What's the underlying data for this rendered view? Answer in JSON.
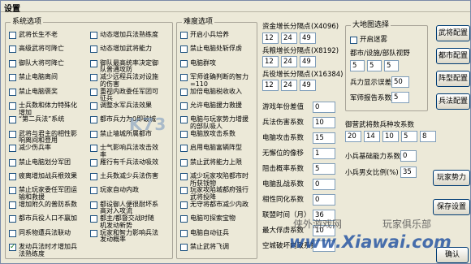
{
  "title": "设置",
  "groups": {
    "system": "系统选项",
    "difficulty": "难度选项",
    "map": "大地图选择",
    "guild": "御营武将数兵种攻系数"
  },
  "system_options": [
    {
      "label": "武将长生不老",
      "checked": false
    },
    {
      "label": "高级武将可降亡",
      "checked": false
    },
    {
      "label": "御队大将可降亡",
      "checked": false
    },
    {
      "label": "禁止电脑离间",
      "checked": false
    },
    {
      "label": "禁止电脑褒奖",
      "checked": false
    },
    {
      "label": "士兵数和体力特殊化增加",
      "checked": false
    },
    {
      "label": "“第二兵法”系统",
      "checked": false
    },
    {
      "label": "武将与君主的相性影响离间和登用",
      "checked": false
    },
    {
      "label": "减少伤兵率",
      "checked": false
    },
    {
      "label": "禁止电脑划分军团",
      "checked": false
    },
    {
      "label": "疲离增加战兵根效果",
      "checked": false
    },
    {
      "label": "禁止玩家委任军团运输和救援",
      "checked": false
    },
    {
      "label": "增加附久的普防系数",
      "checked": false
    },
    {
      "label": "都市兵役人口不赢加",
      "checked": false
    },
    {
      "label": "同系物遭兵法联动",
      "checked": false
    },
    {
      "label": "发动兵法时才增加兵法熟练度",
      "checked": true
    }
  ],
  "system_options_2": [
    {
      "label": "动态增加兵法熟练度",
      "checked": false
    },
    {
      "label": "动态增加武将能力",
      "checked": false
    },
    {
      "label": "御队最高统率决定御队普通攻防",
      "checked": false
    },
    {
      "label": "减少远程兵法对设施的伤害",
      "checked": false
    },
    {
      "label": "重视内政委任军团可征兵",
      "checked": false
    },
    {
      "label": "调整水军兵法效果",
      "checked": false
    },
    {
      "label": "都市兵力为0即破城",
      "checked": false
    },
    {
      "label": "禁止墙城所属都市",
      "checked": false
    },
    {
      "label": "士气影响兵法攻击效率",
      "checked": false
    },
    {
      "label": "雁行有千兵法动吸效",
      "checked": false
    },
    {
      "label": "土兵数减少兵法伤害",
      "checked": false
    },
    {
      "label": "玩家自动内政",
      "checked": false
    },
    {
      "label": "都设御人便很耐坏系高对入攻流",
      "checked": false
    },
    {
      "label": "都主/都督交战时随机发动新势",
      "checked": false
    },
    {
      "label": "玩家和智力影响兵法发动概率",
      "checked": false
    }
  ],
  "difficulty_options": [
    {
      "label": "开启小兵培养",
      "checked": false
    },
    {
      "label": "禁止电脑处斩俘虏",
      "checked": false
    },
    {
      "label": "电脑群攻",
      "checked": false
    },
    {
      "label": "军师谁确判断的智力=110",
      "checked": false
    },
    {
      "label": "加倍电脑税收收入",
      "checked": false
    },
    {
      "label": "允许电脑援力救援",
      "checked": false
    },
    {
      "label": "电脑与玩家势力增援的部队吸人",
      "checked": false
    },
    {
      "label": "电脑放攻击系数",
      "checked": false
    },
    {
      "label": "启用电脑富辆阵型",
      "checked": false
    },
    {
      "label": "禁止武将能力上限",
      "checked": false
    },
    {
      "label": "减少玩家攻陷都市时所获钱物",
      "checked": false
    },
    {
      "label": "玩家攻陷城都府强行武将投降",
      "checked": false
    },
    {
      "label": "无守将都市减少内政",
      "checked": false
    },
    {
      "label": "电脑可探索宝物",
      "checked": false
    },
    {
      "label": "电脑自动征兵",
      "checked": false
    },
    {
      "label": "禁止武将飞调",
      "checked": false
    }
  ],
  "growth": {
    "funds_label": "资金增长分隔点",
    "funds_note": "(X4096)",
    "funds_values": [
      "12",
      "24",
      "49"
    ],
    "soldiers_label": "兵粮增长分隔点",
    "soldiers_note": "(X8192)",
    "soldiers_values": [
      "12",
      "24",
      "49"
    ],
    "troops_label": "兵役增长分隔点",
    "troops_note": "(X16384)",
    "troops_values": [
      "12",
      "24",
      "49"
    ]
  },
  "params": [
    {
      "label": "游戏年份差值",
      "value": "0"
    },
    {
      "label": "兵法伤害系数",
      "value": "10"
    },
    {
      "label": "电脑攻击系数",
      "value": "15"
    },
    {
      "label": "无懈位的像移",
      "value": "1"
    },
    {
      "label": "阻击概率系数",
      "value": "5"
    },
    {
      "label": "电脑乱战系数",
      "value": "0"
    },
    {
      "label": "相性同化系数",
      "value": "0"
    },
    {
      "label": "联盟时间（月）",
      "value": "36"
    },
    {
      "label": "最大俘虏系数",
      "value": "10"
    },
    {
      "label": "空城破坏内政系数",
      "value": ""
    }
  ],
  "map": {
    "enable_label": "开启迷雾",
    "enable_checked": false,
    "row_label": "都市/设施/部队视野",
    "row_values": [
      "5",
      "5",
      "5"
    ],
    "display_label": "兵力显示误差",
    "display_value": "50",
    "report_label": "军师报告系数",
    "report_value": "5"
  },
  "guild_values": [
    "20",
    "14",
    "10",
    "5",
    "8"
  ],
  "guild_params": [
    {
      "label": "小兵基础能力系数",
      "value": "0"
    },
    {
      "label": "小兵男女比例(%)",
      "value": "35"
    }
  ],
  "buttons": {
    "general": "武将配置",
    "city": "都市配置",
    "formation": "阵型配置",
    "tactics": "兵法配置",
    "player": "玩家势力",
    "save": "保存设置",
    "confirm": "确认"
  },
  "watermarks": {
    "site_k73": "K73",
    "site_cn": "侠外游戏网",
    "club": "玩家俱乐部",
    "url": "www.Xiawai.com"
  }
}
